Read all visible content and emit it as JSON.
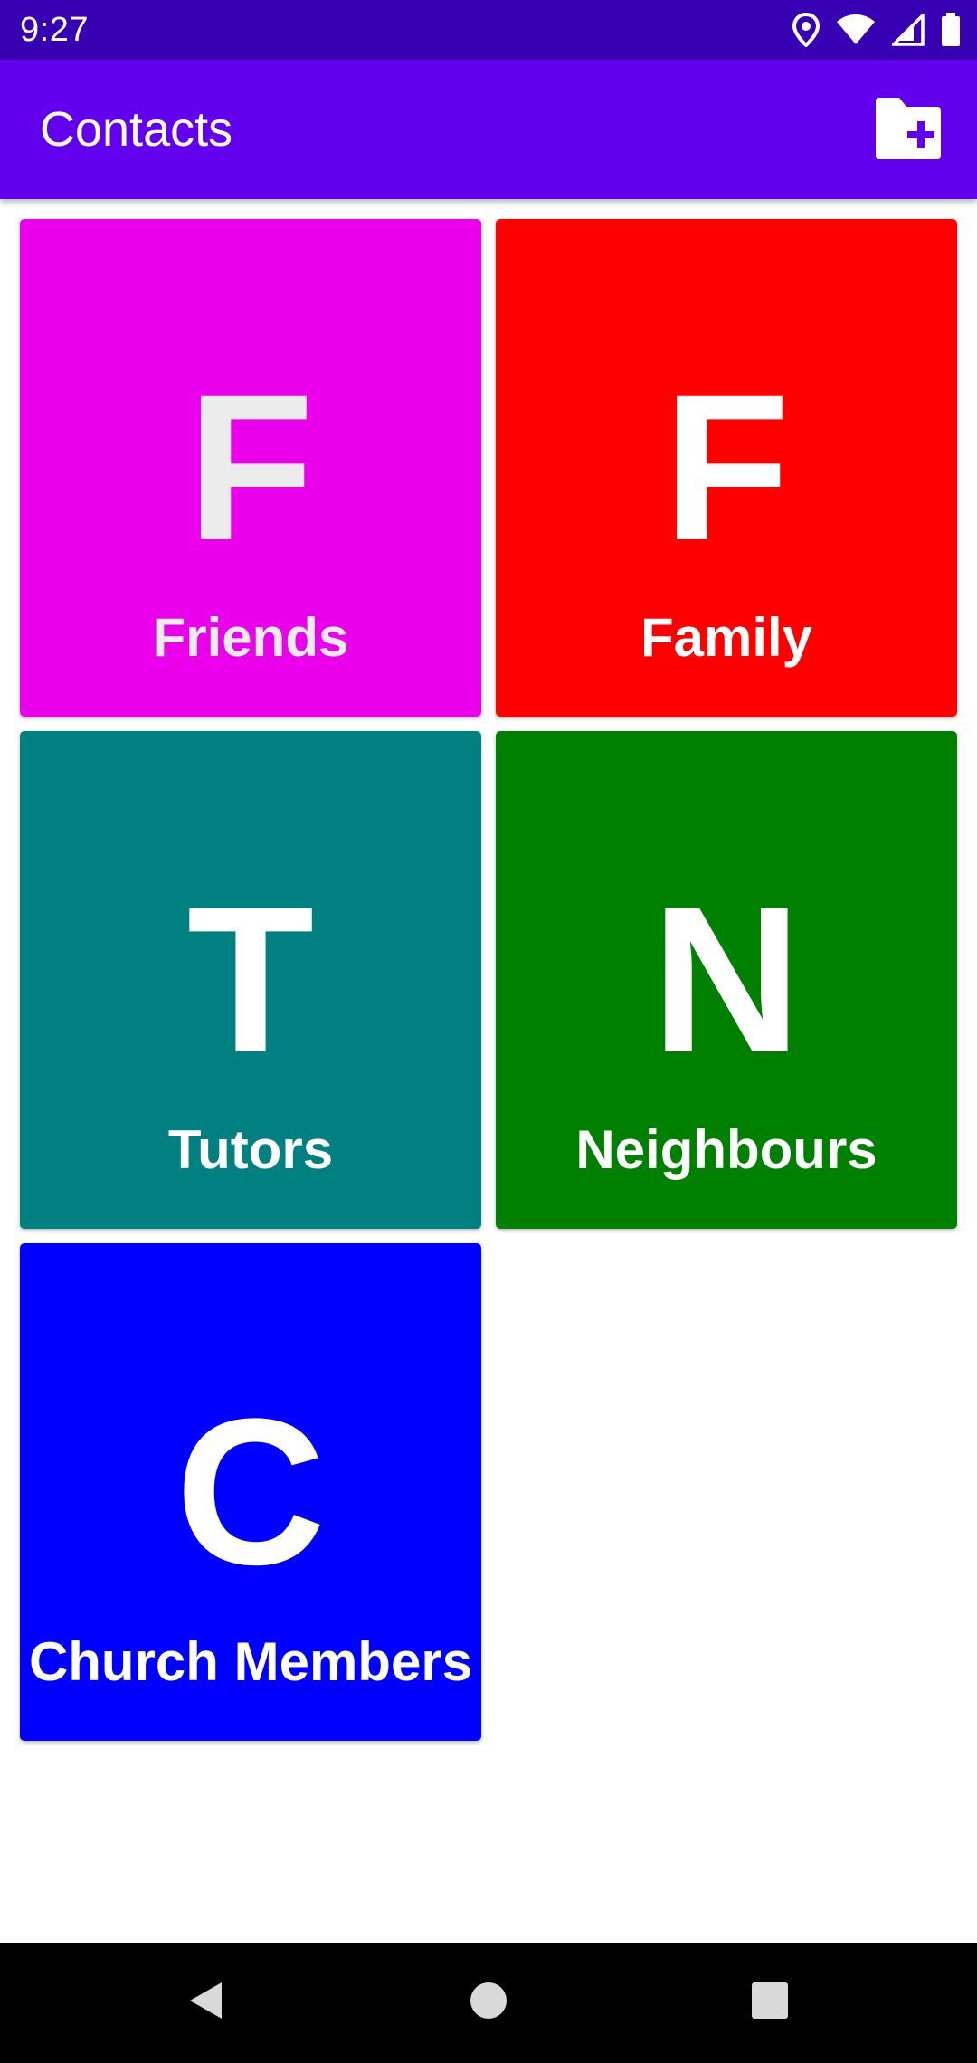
{
  "status_bar": {
    "time": "9:27",
    "icons": [
      "location-icon",
      "wifi-icon",
      "signal-icon",
      "battery-icon"
    ]
  },
  "app_bar": {
    "title": "Contacts",
    "action_icon": "folder-add-icon",
    "color": "#6200ee"
  },
  "groups": [
    {
      "letter": "F",
      "label": "Friends",
      "color": "#ea00ea"
    },
    {
      "letter": "F",
      "label": "Family",
      "color": "#ff0000"
    },
    {
      "letter": "T",
      "label": "Tutors",
      "color": "#008080"
    },
    {
      "letter": "N",
      "label": "Neighbours",
      "color": "#008000"
    },
    {
      "letter": "C",
      "label": "Church Members",
      "color": "#0000ff"
    }
  ],
  "nav_bar": {
    "icons": [
      "back-icon",
      "home-icon",
      "recents-icon"
    ]
  }
}
